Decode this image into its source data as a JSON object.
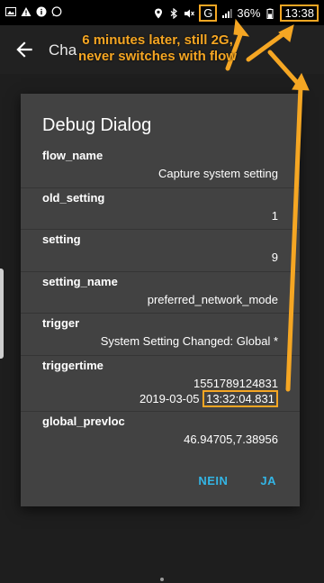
{
  "statusbar": {
    "icons_left": [
      "image-icon",
      "warning-icon",
      "info-icon",
      "whatsapp-icon"
    ],
    "icons_right": [
      "location-icon",
      "bluetooth-icon",
      "mute-icon",
      "wifi-icon",
      "signal-icon"
    ],
    "network_type": "G",
    "battery": "36%",
    "time": "13:38"
  },
  "appbar": {
    "title_visible": "Cha"
  },
  "dialog": {
    "title": "Debug Dialog",
    "rows": [
      {
        "key": "flow_name",
        "value": "Capture system setting"
      },
      {
        "key": "old_setting",
        "value": "1"
      },
      {
        "key": "setting",
        "value": "9"
      },
      {
        "key": "setting_name",
        "value": "preferred_network_mode"
      },
      {
        "key": "trigger",
        "value": "System Setting Changed: Global *"
      },
      {
        "key": "triggertime",
        "value": "1551789124831",
        "value2_date": "2019-03-05",
        "value2_time": "13:32:04.831"
      },
      {
        "key": "global_prevloc",
        "value": "46.94705,7.38956"
      }
    ],
    "buttons": {
      "negative": "NEIN",
      "positive": "JA"
    }
  },
  "annotation": {
    "line1": "6 minutes later, still 2G,",
    "line2": "never switches with flow",
    "color": "#f5a623"
  }
}
